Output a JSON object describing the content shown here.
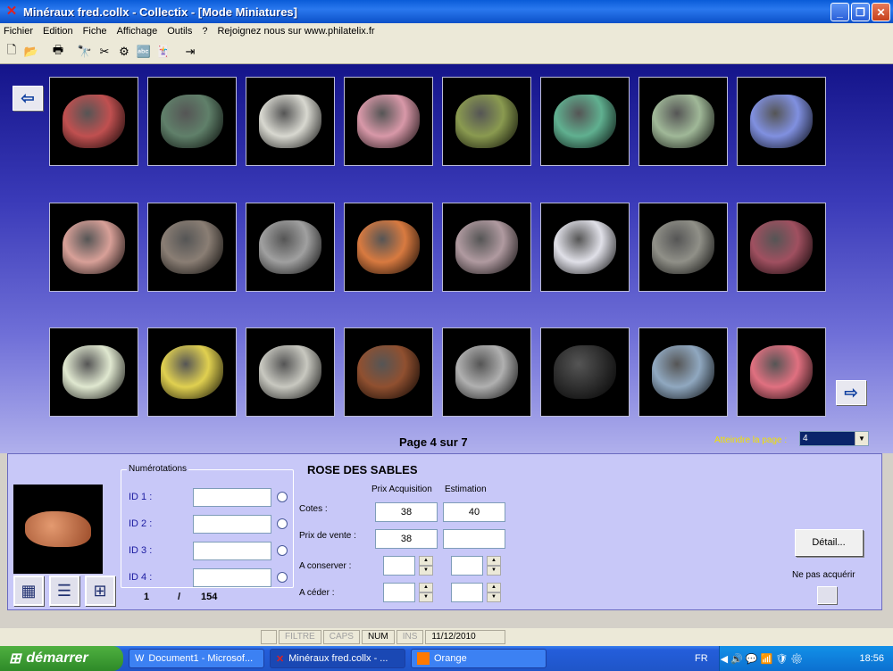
{
  "window": {
    "title": "Minéraux fred.collx - Collectix - [Mode Miniatures]"
  },
  "menu": [
    "Fichier",
    "Edition",
    "Fiche",
    "Affichage",
    "Outils",
    "?",
    "Rejoignez nous sur www.philatelix.fr"
  ],
  "toolbar_icons": [
    "new-icon",
    "open-icon",
    "print-icon",
    "find-icon",
    "tool-icon",
    "settings-icon",
    "abc-icon",
    "cards-icon",
    "exit-icon"
  ],
  "thumbnail_colors": [
    "#c05050",
    "#60806a",
    "#d8d8d0",
    "#d898a8",
    "#8a9a50",
    "#60b090",
    "#a0b898",
    "#8090e0",
    "#d8a098",
    "#8a7e74",
    "#a0a0a0",
    "#d87a40",
    "#b09aa0",
    "#e0e0e8",
    "#909088",
    "#a05060",
    "#e0e8d0",
    "#e0d050",
    "#c8c8c0",
    "#905030",
    "#b0b0b0",
    "#303030",
    "#90a8c0",
    "#e07080"
  ],
  "pagination": {
    "label": "Page 4 sur 7",
    "goto_label": "Atteindre la page :",
    "goto_value": "4"
  },
  "detail_panel": {
    "group_title": "Numérotations",
    "id_labels": [
      "ID 1 :",
      "ID 2 :",
      "ID 3 :",
      "ID 4 :"
    ],
    "counter_current": "1",
    "counter_sep": "/",
    "counter_total": "154",
    "mineral_name": "ROSE DES SABLES",
    "col_prix_acquisition": "Prix Acquisition",
    "col_estimation": "Estimation",
    "row_cotes": "Cotes :",
    "row_prix_vente": "Prix de vente :",
    "row_a_conserver": "A conserver :",
    "row_a_ceder": "A céder :",
    "cotes_acquisition": "38",
    "cotes_estimation": "40",
    "vente_acquisition": "38",
    "vente_estimation": "",
    "detail_button": "Détail...",
    "ne_pas_acquerir": "Ne pas acquérir"
  },
  "statusbar": {
    "filtre": "FILTRE",
    "caps": "CAPS",
    "num": "NUM",
    "ins": "INS",
    "date": "11/12/2010"
  },
  "taskbar": {
    "start": "démarrer",
    "tasks": [
      "Document1 - Microsof...",
      "Minéraux fred.collx - ...",
      "Orange"
    ],
    "lang": "FR",
    "clock": "18:56"
  }
}
